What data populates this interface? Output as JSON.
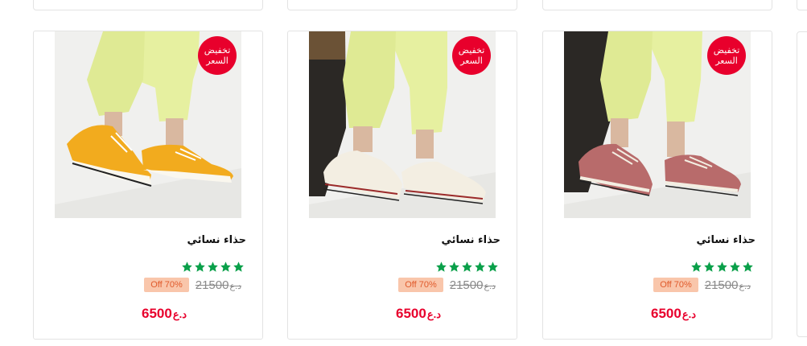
{
  "products": [
    {
      "sale_badge_line1": "تخفيض",
      "sale_badge_line2": "السعر",
      "title": "حذاء نسائي",
      "rating": 5,
      "old_price": "21500",
      "old_currency": "د.ع",
      "discount": "Off 70%",
      "price": "6500",
      "currency": "د.ع",
      "shoe_color": "#f2ab1e",
      "shoe_color_name": "yellow"
    },
    {
      "sale_badge_line1": "تخفيض",
      "sale_badge_line2": "السعر",
      "title": "حذاء نسائي",
      "rating": 5,
      "old_price": "21500",
      "old_currency": "د.ع",
      "discount": "Off 70%",
      "price": "6500",
      "currency": "د.ع",
      "shoe_color": "#f3eee2",
      "shoe_color_name": "cream"
    },
    {
      "sale_badge_line1": "تخفيض",
      "sale_badge_line2": "السعر",
      "title": "حذاء نسائي",
      "rating": 5,
      "old_price": "21500",
      "old_currency": "د.ع",
      "discount": "Off 70%",
      "price": "6500",
      "currency": "د.ع",
      "shoe_color": "#b86b6b",
      "shoe_color_name": "rose"
    }
  ],
  "colors": {
    "sale_red": "#e8002c",
    "star_green": "#0aa04a",
    "discount_bg": "#f9c6ab",
    "discount_text": "#e05a2b",
    "pants": "#e6f0a0"
  }
}
